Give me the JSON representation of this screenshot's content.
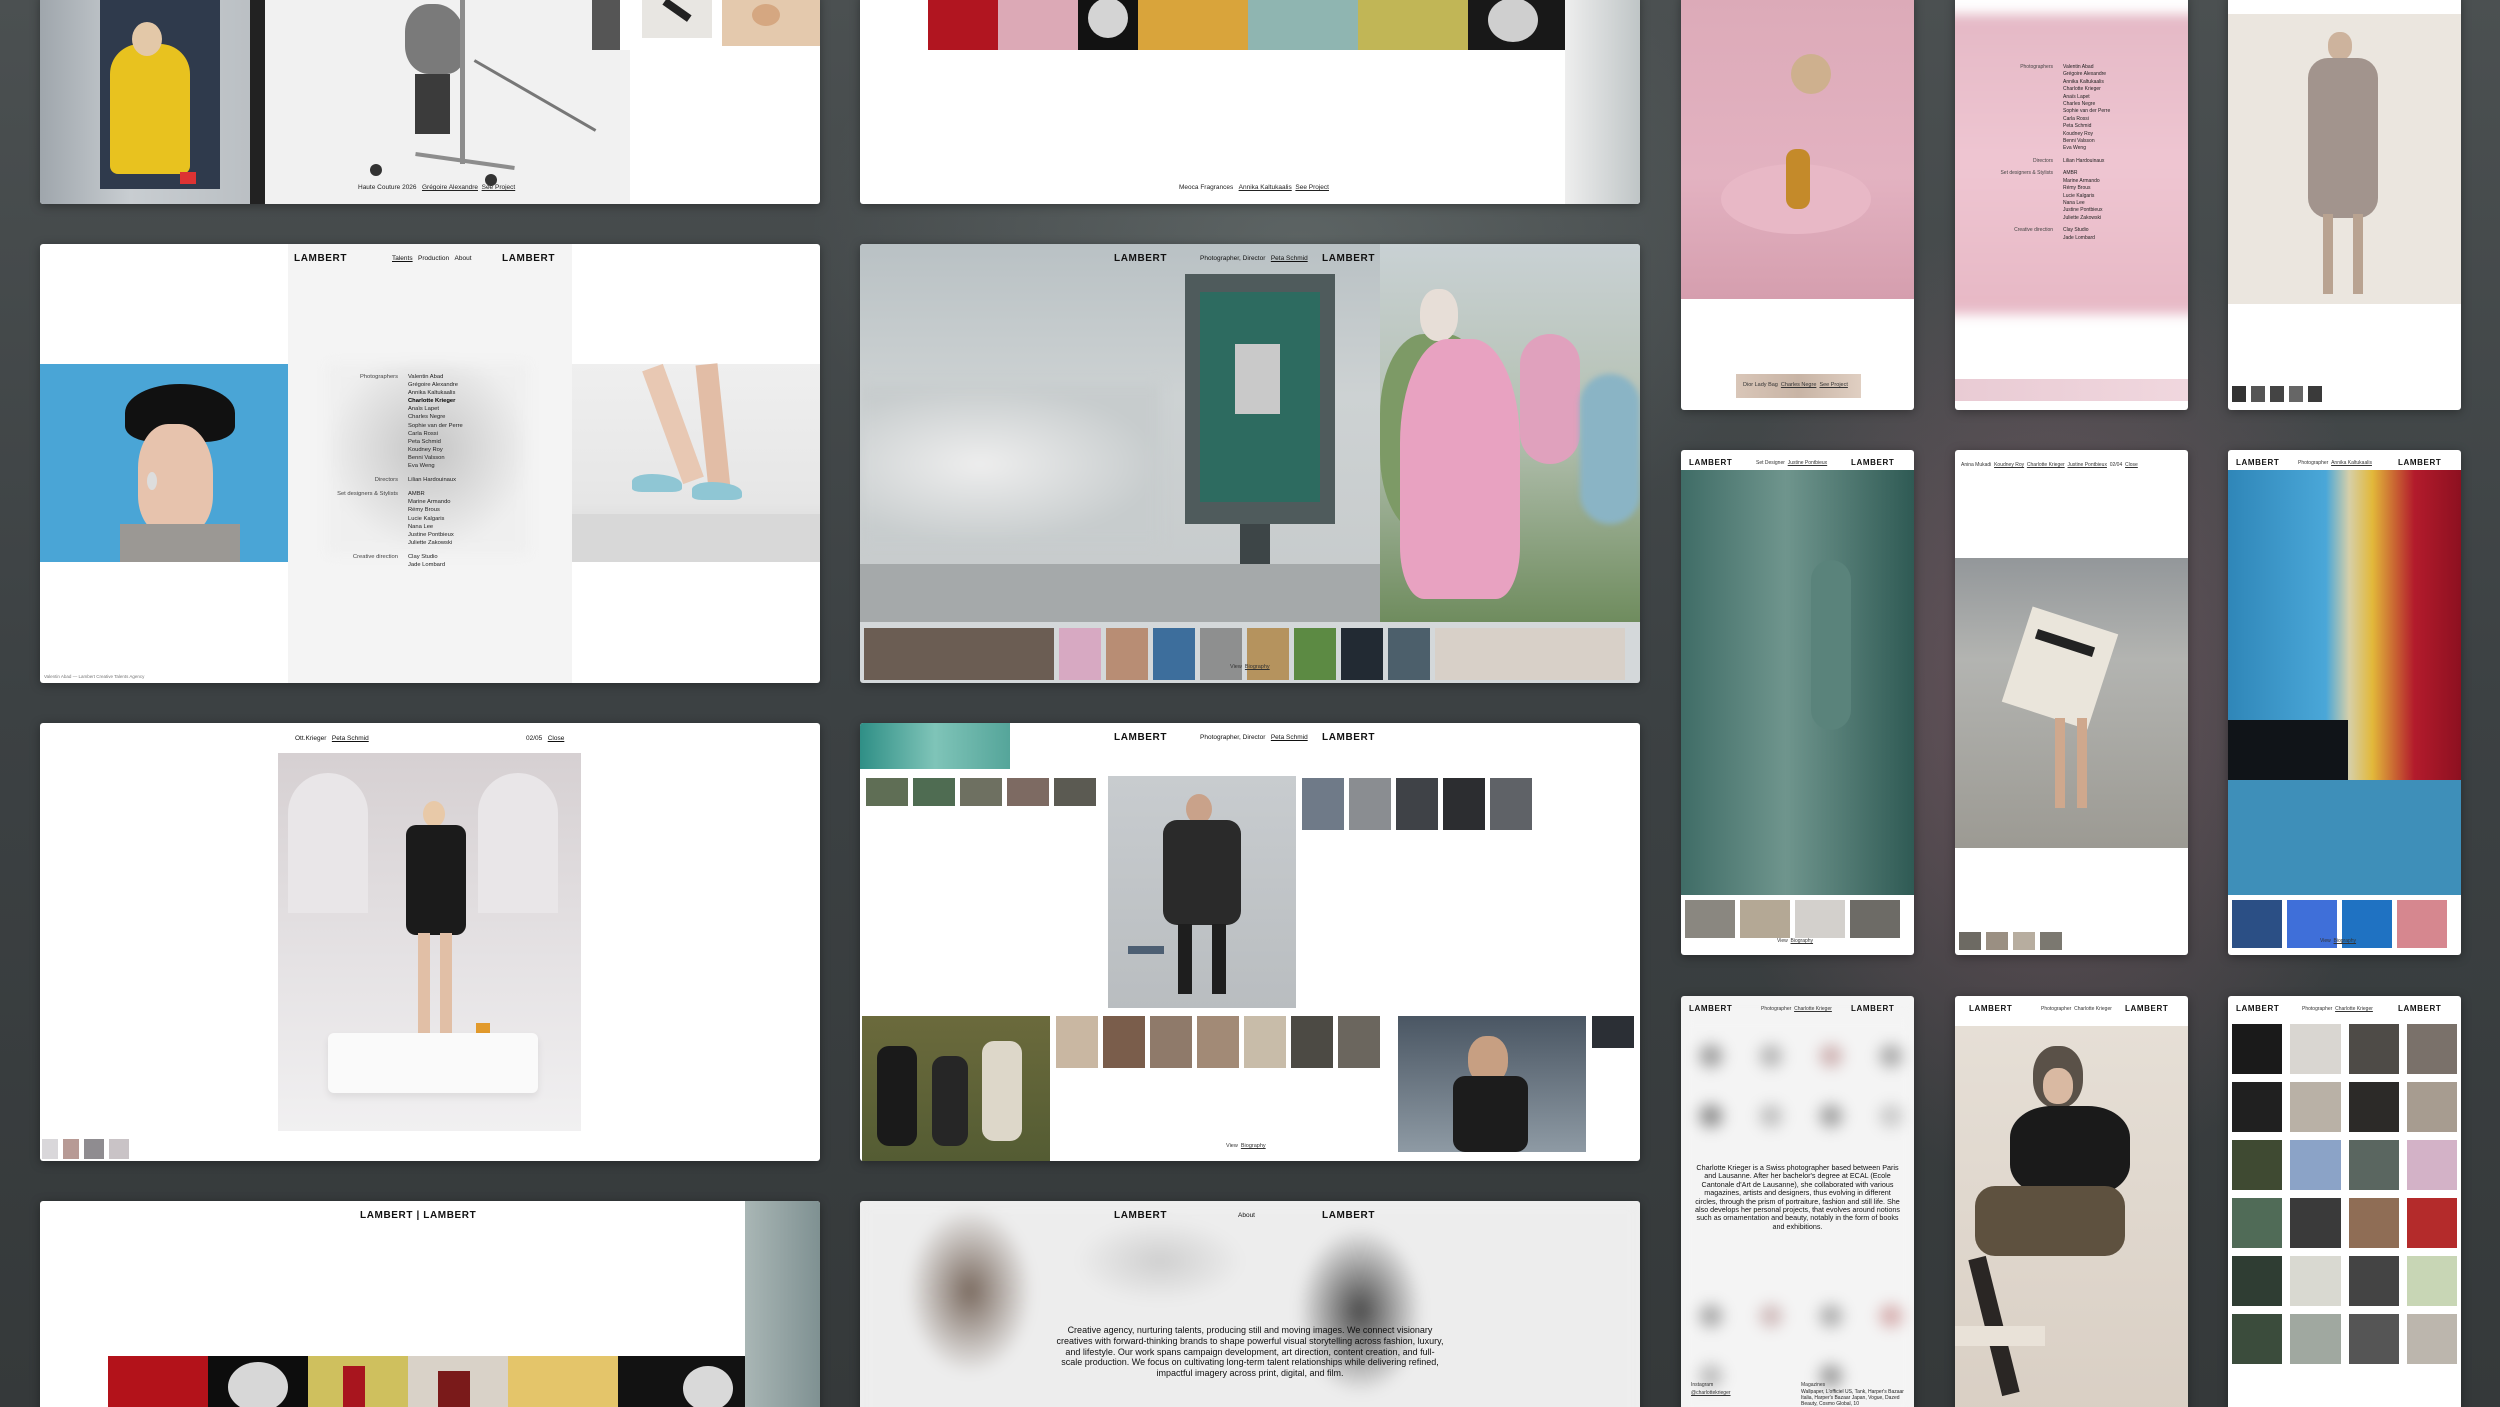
{
  "brand": {
    "name": "LAMBERT",
    "name_pair": "LAMBERT | LAMBERT"
  },
  "nav": {
    "talents": "Talents",
    "production": "Production",
    "about": "About"
  },
  "cards": {
    "couture": {
      "caption": "Haute Couture 2026",
      "name": "Grégoire Alexandre",
      "link": "See Project"
    },
    "fragrances": {
      "caption": "Meoca Fragrances",
      "name": "Annika Kaltukaalis",
      "link": "See Project"
    },
    "talents": {
      "roster": [
        {
          "role": "Photographers",
          "names": [
            "Valentin Abad",
            "Grégoire Alexandre",
            "Annika Kaltukaalis",
            "Charlotte Krieger",
            "Anaïs Lapet",
            "Charles Negre",
            "Sophie van der Perre",
            "Carla Rossi",
            "Peta Schmid",
            "Koudney Roy",
            "Benni Valsson",
            "Eva Weng"
          ]
        },
        {
          "role": "Directors",
          "names": [
            "Lilian Hardouinaux"
          ]
        },
        {
          "role": "Set designers & Stylists",
          "names": [
            "AMBR",
            "Marine Armando",
            "Rémy Brous",
            "Lucie Kalgaris",
            "Nana Lee",
            "Justine Pontbieux",
            "Juliette Zakowski"
          ]
        },
        {
          "role": "Creative direction",
          "names": [
            "Clay Studio",
            "Jade Lombard"
          ]
        }
      ],
      "footnote": "Valentin Abad — Lambert Creative Talents Agency"
    },
    "booth": {
      "role": "Photographer, Director",
      "name": "Peta Schmid",
      "view": "View",
      "bio": "Biography"
    },
    "krieger_gallery": {
      "left": "Ott.Krieger",
      "name": "Peta Schmid",
      "counter": "02/05",
      "close": "Close"
    },
    "schmid_gallery": {
      "role": "Photographer, Director",
      "name": "Peta Schmid",
      "view": "View",
      "bio": "Biography"
    },
    "about": {
      "nav": "About",
      "text": "Creative agency, nurturing talents, producing still and moving images. We connect visionary creatives with forward-thinking brands to shape powerful visual storytelling across fashion, luxury, and lifestyle. Our work spans campaign development, art direction, content creation, and full-scale production. We focus on cultivating long-term talent relationships while delivering refined, impactful imagery across print, digital, and film."
    },
    "bag": {
      "caption": "Dior Lady Bag",
      "name": "Charles Negre",
      "link": "See Project"
    },
    "list2": {
      "roles": [
        "Photographers",
        "Directors",
        "Set designers & Stylists",
        "Creative direction"
      ],
      "photographers": [
        "Valentin Abad",
        "Grégoire Alexandre",
        "Annika Kaltukaalis",
        "Charlotte Krieger",
        "Anaïs Lapet",
        "Charles Negre",
        "Sophie van der Perre",
        "Carla Rossi",
        "Peta Schmid",
        "Koudney Roy",
        "Benni Valsson",
        "Eva Weng"
      ],
      "directors": [
        "Lilian Hardouinaux"
      ],
      "stylists": [
        "AMBR",
        "Marine Armando",
        "Rémy Brous",
        "Lucie Kalgaris",
        "Nana Lee",
        "Justine Pontbieux",
        "Juliette Zakowski"
      ],
      "creative": [
        "Clay Studio",
        "Jade Lombard"
      ]
    },
    "mobile_setdesigner": {
      "role": "Set Designer",
      "name": "Justine Pontbieux",
      "view": "View",
      "bio": "Biography"
    },
    "mobile_mukadi": {
      "a": "Anina Mukadi",
      "b": "Koudney Roy",
      "c": "Charlotte Krieger",
      "d": "Justine Pontbieux",
      "counter": "02/04",
      "close": "Close"
    },
    "mobile_kaltukaalis": {
      "role": "Photographer",
      "name": "Annika Kaltukaalis",
      "view": "View",
      "bio": "Biography"
    },
    "mobile_krieger_bio": {
      "role": "Photographer",
      "name": "Charlotte Krieger",
      "bio": "Charlotte Krieger is a Swiss photographer based between Paris and Lausanne. After her bachelor's degree at ECAL (Ecole Cantonale d'Art de Lausanne), she collaborated with various magazines, artists and designers, thus evolving in different circles, through the prism of portraiture, fashion and still life. She also develops her personal projects, that evolves around notions such as ornamentation and beauty, notably in the form of books and exhibitions.",
      "mag_label": "Magazines",
      "mags": "Wallpaper, L'officiel US, Tank, Harper's Bazaar Italia, Harper's Bazaar Japan, Vogue, Dazed Beauty, Cosmo Global, 10",
      "insta_label": "Instagram",
      "insta": "@charlottekrieger"
    },
    "mobile_krieger": {
      "role": "Photographer",
      "name": "Charlotte Krieger"
    },
    "mobile_grid": {
      "role": "Photographer",
      "name": "Charlotte Krieger"
    }
  },
  "colors": {
    "background": "#3d4244",
    "card": "#ffffff",
    "accent_pink": "#e5a9be",
    "accent_blue": "#57a8d8",
    "yellow": "#e9c32a"
  }
}
